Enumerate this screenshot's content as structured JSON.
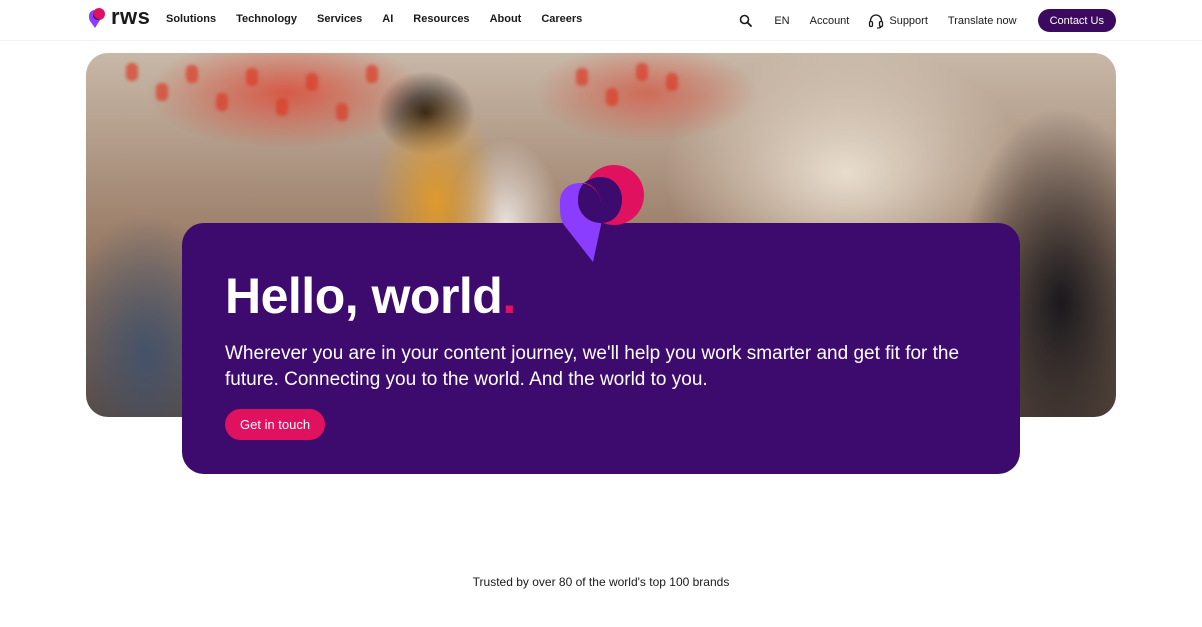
{
  "header": {
    "logo_text": "rws",
    "nav": [
      "Solutions",
      "Technology",
      "Services",
      "AI",
      "Resources",
      "About",
      "Careers"
    ],
    "lang": "EN",
    "account": "Account",
    "support": "Support",
    "translate": "Translate now",
    "contact": "Contact Us",
    "icons": {
      "search": "search-icon",
      "support": "headset-icon",
      "logo": "rws-logo-icon"
    }
  },
  "hero": {
    "headline": "Hello, world",
    "headline_dot": ".",
    "subtext": "Wherever you are in your content journey, we'll help you work smarter and get fit for the future. Connecting you to the world. And the world to you.",
    "cta": "Get in touch"
  },
  "trusted": "Trusted by over 80 of the world's top 100 brands",
  "colors": {
    "primary_purple": "#3d0a6e",
    "dark_purple_button": "#3b0a5e",
    "accent_pink": "#e0115f",
    "mark_violet": "#8b3dff"
  }
}
